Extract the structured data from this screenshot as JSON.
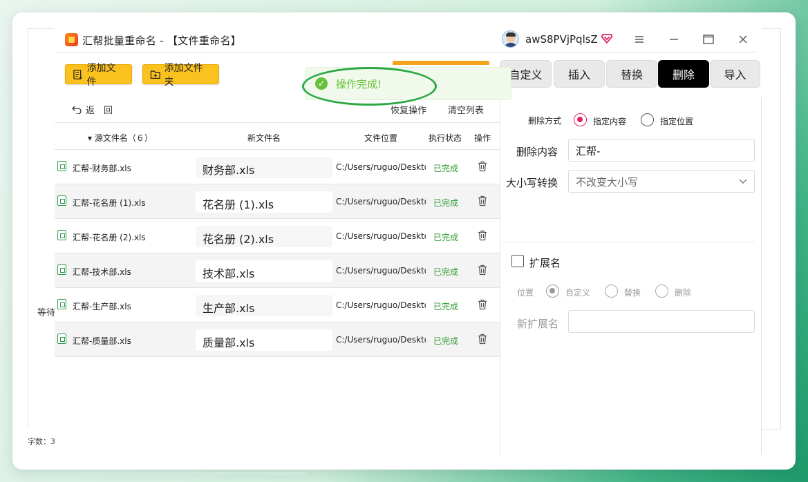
{
  "bg": {
    "wait_label": "等待",
    "count_label": "字数：3"
  },
  "title": {
    "app_name": "汇帮批量重命名 - 【文件重命名】",
    "username": "awS8PVjPqlsZ"
  },
  "toolbar": {
    "add_file": "添加文件",
    "add_folder": "添加文件夹"
  },
  "toast": {
    "message": "操作完成!"
  },
  "tabs": [
    {
      "label": "自定义"
    },
    {
      "label": "插入"
    },
    {
      "label": "替换"
    },
    {
      "label": "删除"
    },
    {
      "label": "导入"
    }
  ],
  "actions": {
    "back": "返　回",
    "restore": "恢复操作",
    "clear": "清空列表"
  },
  "table": {
    "headers": {
      "source": "▾ 源文件名（６）",
      "new_name": "新文件名",
      "location": "文件位置",
      "status": "执行状态",
      "op": "操作"
    },
    "rows": [
      {
        "source": "汇帮-财务部.xls",
        "new_name": "财务部.xls",
        "location": "C:/Users/ruguo/Desktop",
        "status": "已完成"
      },
      {
        "source": "汇帮-花名册 (1).xls",
        "new_name": "花名册 (1).xls",
        "location": "C:/Users/ruguo/Desktop",
        "status": "已完成"
      },
      {
        "source": "汇帮-花名册 (2).xls",
        "new_name": "花名册 (2).xls",
        "location": "C:/Users/ruguo/Desktop",
        "status": "已完成"
      },
      {
        "source": "汇帮-技术部.xls",
        "new_name": "技术部.xls",
        "location": "C:/Users/ruguo/Desktop",
        "status": "已完成"
      },
      {
        "source": "汇帮-生产部.xls",
        "new_name": "生产部.xls",
        "location": "C:/Users/ruguo/Desktop",
        "status": "已完成"
      },
      {
        "source": "汇帮-质量部.xls",
        "new_name": "质量部.xls",
        "location": "C:/Users/ruguo/Desktop",
        "status": "已完成"
      }
    ]
  },
  "panel": {
    "delete_mode_label": "删除方式",
    "mode_content": "指定内容",
    "mode_position": "指定位置",
    "content_label": "删除内容",
    "content_value": "汇帮-",
    "case_label": "大小写转换",
    "case_value": "不改变大小写",
    "ext_label": "扩展名",
    "pos_label": "位置",
    "pos_custom": "自定义",
    "pos_replace": "替换",
    "pos_delete": "删除",
    "new_ext_label": "新扩展名",
    "new_ext_value": ""
  },
  "colors": {
    "accent": "#fbc21f",
    "active_tab": "#000000",
    "success": "#67c23a",
    "radio_on": "#e0245e"
  }
}
